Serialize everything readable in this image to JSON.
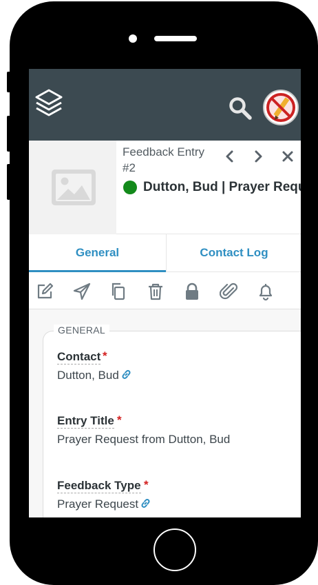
{
  "app": {
    "logo_icon": "layers-stack-icon",
    "search_icon": "search-icon",
    "avatar_icon": "no-pencil-avatar-icon"
  },
  "record": {
    "type_label": "Feedback Entry",
    "id_label": "#2",
    "name": "Dutton, Bud | Prayer Request from Dutton, Bud",
    "status_color": "#138a1b",
    "thumbnail_icon": "image-placeholder-icon"
  },
  "navigation": {
    "prev_icon": "chevron-left-icon",
    "next_icon": "chevron-right-icon",
    "close_icon": "close-icon"
  },
  "tabs": [
    {
      "label": "General",
      "active": true
    },
    {
      "label": "Contact Log",
      "active": false
    }
  ],
  "toolbar": [
    "edit-icon",
    "send-icon",
    "copy-icon",
    "delete-icon",
    "lock-icon",
    "attach-icon",
    "bell-icon"
  ],
  "form": {
    "section_title": "GENERAL",
    "fields": [
      {
        "label": "Contact",
        "required_mark": "*",
        "value": "Dutton, Bud",
        "linked": true
      },
      {
        "label": "Entry Title",
        "required_mark": "*",
        "value": "Prayer Request from Dutton, Bud",
        "linked": false
      },
      {
        "label": "Feedback Type",
        "required_mark": "*",
        "value": "Prayer Request",
        "linked": true
      }
    ]
  },
  "colors": {
    "header_bg": "#3c4a51",
    "accent": "#2f8fc2",
    "required": "#d31f1f"
  }
}
